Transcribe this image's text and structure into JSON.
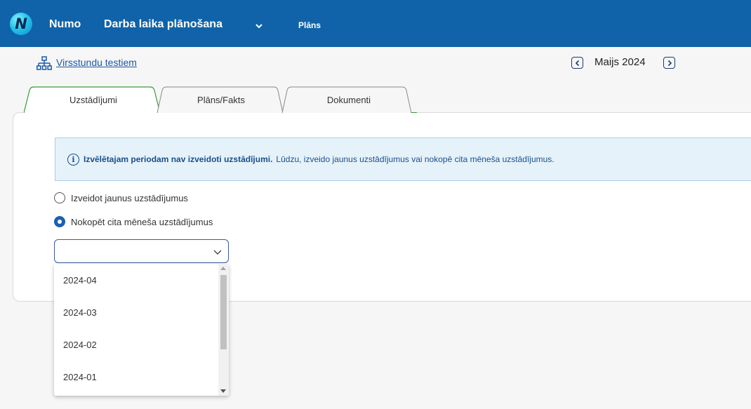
{
  "header": {
    "logo_letter": "N",
    "app_name": "Numo",
    "module_name": "Darba laika plānošana",
    "nav_plans": "Plāns"
  },
  "subheader": {
    "org_link": "Virsstundu testiem",
    "period_label": "Maijs 2024"
  },
  "tabs": [
    {
      "label": "Uzstādījumi",
      "active": true
    },
    {
      "label": "Plāns/Fakts",
      "active": false
    },
    {
      "label": "Dokumenti",
      "active": false
    }
  ],
  "info": {
    "bold_text": "Izvēlētajam periodam nav izveidoti uzstādījumi.",
    "text": "Lūdzu, izveido jaunus uzstādījumus vai nokopē cita mēneša uzstādījumus."
  },
  "options": {
    "create_new": "Izveidot jaunus uzstādījumus",
    "copy_other": "Nokopēt cita mēneša uzstādījumus",
    "selected": "copy_other"
  },
  "month_select": {
    "value": "",
    "items": [
      "2024-04",
      "2024-03",
      "2024-02",
      "2024-01"
    ]
  },
  "colors": {
    "header_bg": "#1063a8",
    "tab_border": "#3a9a3a",
    "accent": "#1a5fb4",
    "info_bg": "#e6f2fa"
  }
}
